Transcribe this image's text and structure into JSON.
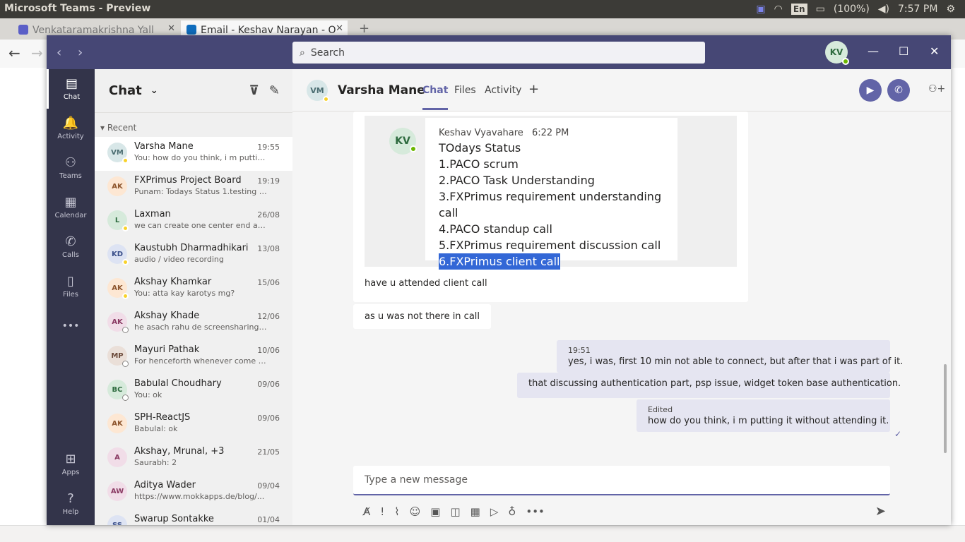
{
  "os": {
    "app_title": "Microsoft Teams - Preview",
    "lang": "En",
    "battery": "(100%)",
    "clock": "7:57 PM"
  },
  "browser": {
    "tabs": [
      {
        "label": "Venkataramakrishna Yall",
        "active": false
      },
      {
        "label": "Email - Keshav Narayan - O",
        "active": true
      }
    ],
    "new_tab": "+"
  },
  "teams": {
    "search_placeholder": "Search",
    "me_initials": "KV",
    "rail": [
      {
        "label": "Chat",
        "icon": "chat-icon",
        "glyph": "▤"
      },
      {
        "label": "Activity",
        "icon": "bell-icon",
        "glyph": "🔔"
      },
      {
        "label": "Teams",
        "icon": "teams-icon",
        "glyph": "⚇"
      },
      {
        "label": "Calendar",
        "icon": "calendar-icon",
        "glyph": "▦"
      },
      {
        "label": "Calls",
        "icon": "phone-icon",
        "glyph": "✆"
      },
      {
        "label": "Files",
        "icon": "file-icon",
        "glyph": "▯"
      },
      {
        "label": "",
        "icon": "more-icon",
        "glyph": "•••"
      },
      {
        "label": "Apps",
        "icon": "apps-icon",
        "glyph": "⊞"
      },
      {
        "label": "Help",
        "icon": "help-icon",
        "glyph": "?"
      }
    ],
    "list_title": "Chat",
    "recent_label": "Recent",
    "chats": [
      {
        "initials": "VM",
        "name": "Varsha Mane",
        "time": "19:55",
        "preview": "You: how do you think, i m puttin...",
        "bg": "#d8e7e8",
        "fg": "#4c6e72",
        "presence": "away"
      },
      {
        "initials": "AK",
        "name": "FXPrimus Project Board",
        "time": "19:19",
        "preview": "Punam: Todays Status 1.testing x...",
        "bg": "#fde7d3",
        "fg": "#8e562e",
        "presence": "none"
      },
      {
        "initials": "L",
        "name": "Laxman",
        "time": "26/08",
        "preview": "we can create one center end an...",
        "bg": "#d6eadb",
        "fg": "#2e6b3f",
        "presence": "away"
      },
      {
        "initials": "KD",
        "name": "Kaustubh Dharmadhikari",
        "time": "13/08",
        "preview": "audio / video recording",
        "bg": "#dde3f3",
        "fg": "#3a4f8a",
        "presence": "away"
      },
      {
        "initials": "AK",
        "name": "Akshay Khamkar",
        "time": "15/06",
        "preview": "You: atta kay karotys mg?",
        "bg": "#fde7d3",
        "fg": "#8e562e",
        "presence": "away"
      },
      {
        "initials": "AK",
        "name": "Akshay Khade",
        "time": "12/06",
        "preview": "he asach rahu de screensharing s...",
        "bg": "#f1dde8",
        "fg": "#8a3a63",
        "presence": "off"
      },
      {
        "initials": "MP",
        "name": "Mayuri Pathak",
        "time": "10/06",
        "preview": "For henceforth whenever come p...",
        "bg": "#eadfd8",
        "fg": "#6b4a3a",
        "presence": "off"
      },
      {
        "initials": "BC",
        "name": "Babulal Choudhary",
        "time": "09/06",
        "preview": "You: ok",
        "bg": "#d6eadb",
        "fg": "#2e6b3f",
        "presence": "off"
      },
      {
        "initials": "AK",
        "name": "SPH-ReactJS",
        "time": "09/06",
        "preview": "Babulal: ok",
        "bg": "#fde7d3",
        "fg": "#8e562e",
        "presence": "none"
      },
      {
        "initials": "A",
        "name": "Akshay, Mrunal, +3",
        "time": "21/05",
        "preview": "Saurabh: 2",
        "bg": "#f1dde8",
        "fg": "#8a3a63",
        "presence": "none"
      },
      {
        "initials": "AW",
        "name": "Aditya Wader",
        "time": "09/04",
        "preview": "https://www.mokkapps.de/blog/...",
        "bg": "#f1dde8",
        "fg": "#8a3a63",
        "presence": "none"
      },
      {
        "initials": "SS",
        "name": "Swarup Sontakke",
        "time": "01/04",
        "preview": "",
        "bg": "#dde3f3",
        "fg": "#3a4f8a",
        "presence": "none"
      }
    ],
    "chat": {
      "initials": "VM",
      "name": "Varsha Mane",
      "tabs": [
        "Chat",
        "Files",
        "Activity"
      ],
      "add_tab": "+",
      "quoted": {
        "initials": "KV",
        "author": "Keshav Vyavahare",
        "time": "6:22 PM",
        "lines": [
          "TOdays Status",
          "1.PACO scrum",
          "2.PACO Task Understanding",
          "3.FXPrimus requirement understanding call",
          "4.PACO standup call",
          "5.FXPrimus requirement discussion call"
        ],
        "highlighted": "6.FXPrimus  client call"
      },
      "incoming": [
        "have u attended client call",
        "as u was not there in call"
      ],
      "outgoing": [
        {
          "meta": "19:51",
          "text": "yes, i was, first 10 min not able to connect, but after that i was part of it."
        },
        {
          "meta": "",
          "text": "that discussing authentication part, psp issue,  widget token base authentication."
        },
        {
          "meta": "Edited",
          "text": "how do you think, i m putting it without attending it."
        }
      ],
      "compose_placeholder": "Type a new message"
    }
  },
  "colors": {
    "teams_purple": "#6264a7",
    "header": "#464775",
    "rail": "#33344a"
  }
}
